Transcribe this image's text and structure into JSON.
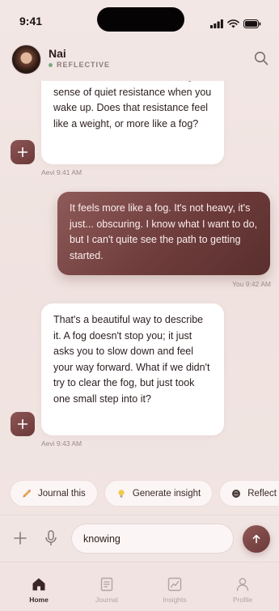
{
  "status_bar": {
    "time": "9:41"
  },
  "header": {
    "name": "Nai",
    "status": "REFLECTIVE"
  },
  "messages": [
    {
      "sender": "ai",
      "text": "session. You mentioned feeling a sense of quiet resistance when you wake up. Does that resistance feel like a weight, or more like a fog?",
      "timestamp": "Aevi 9:41 AM"
    },
    {
      "sender": "user",
      "text": "It feels more like a fog. It's not heavy, it's just... obscuring. I know what I want to do, but I can't quite see the path to getting started.",
      "timestamp": "You 9:42 AM"
    },
    {
      "sender": "ai",
      "text": "That's a beautiful way to describe it. A fog doesn't stop you; it just asks you to slow down and feel your way forward. What if we didn't try to clear the fog, but just took one small step into it?",
      "timestamp": "Aevi 9:43 AM"
    }
  ],
  "chips": [
    {
      "label": "Journal this",
      "icon": "pencil-icon"
    },
    {
      "label": "Generate insight",
      "icon": "lightbulb-icon"
    },
    {
      "label": "Reflect m",
      "icon": "brain-icon"
    }
  ],
  "composer": {
    "value": "knowing",
    "plus_icon": "plus-icon",
    "mic_icon": "microphone-icon",
    "send_icon": "arrow-up-icon"
  },
  "tabs": [
    {
      "label": "Home",
      "icon": "home-icon",
      "active": true
    },
    {
      "label": "Journal",
      "icon": "journal-icon",
      "active": false
    },
    {
      "label": "Insights",
      "icon": "chart-icon",
      "active": false
    },
    {
      "label": "Profile",
      "icon": "person-icon",
      "active": false
    }
  ],
  "colors": {
    "accent": "#6d3c3b",
    "background": "#efe3e1",
    "status_dot": "#7cab7e"
  }
}
